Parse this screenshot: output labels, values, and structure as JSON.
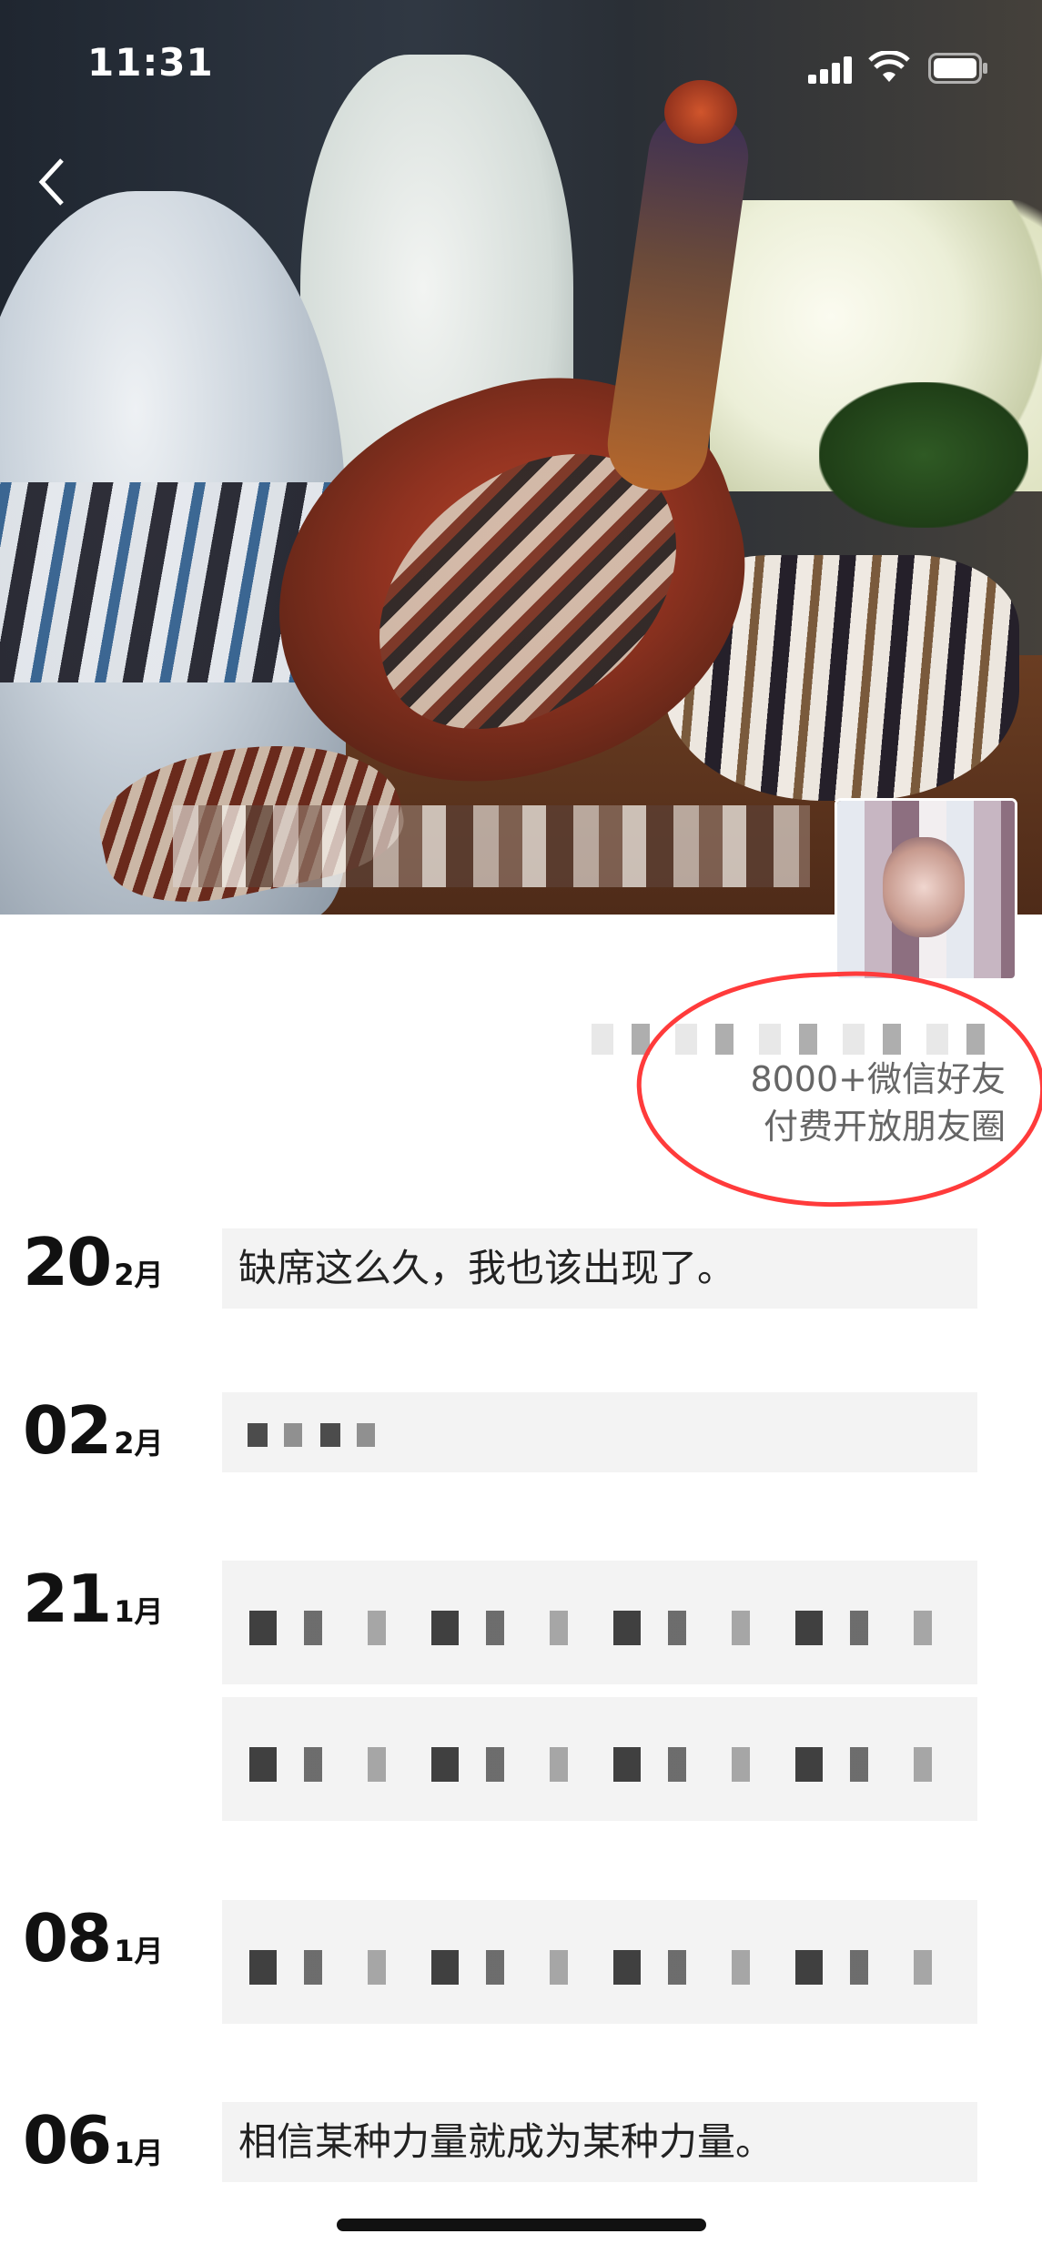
{
  "status_bar": {
    "time": "11:31"
  },
  "profile": {
    "signature_line1": "8000+微信好友",
    "signature_line2": "付费开放朋友圈"
  },
  "posts": [
    {
      "day": "20",
      "month": "2月",
      "text": "缺席这么久，我也该出现了。"
    },
    {
      "day": "02",
      "month": "2月",
      "text": ""
    },
    {
      "day": "21",
      "month": "1月",
      "text": ""
    },
    {
      "day": "08",
      "month": "1月",
      "text": ""
    },
    {
      "day": "06",
      "month": "1月",
      "text": "相信某种力量就成为某种力量。"
    }
  ],
  "colors": {
    "annotation": "#ff3b3b",
    "bubble_bg": "#f3f3f3"
  }
}
